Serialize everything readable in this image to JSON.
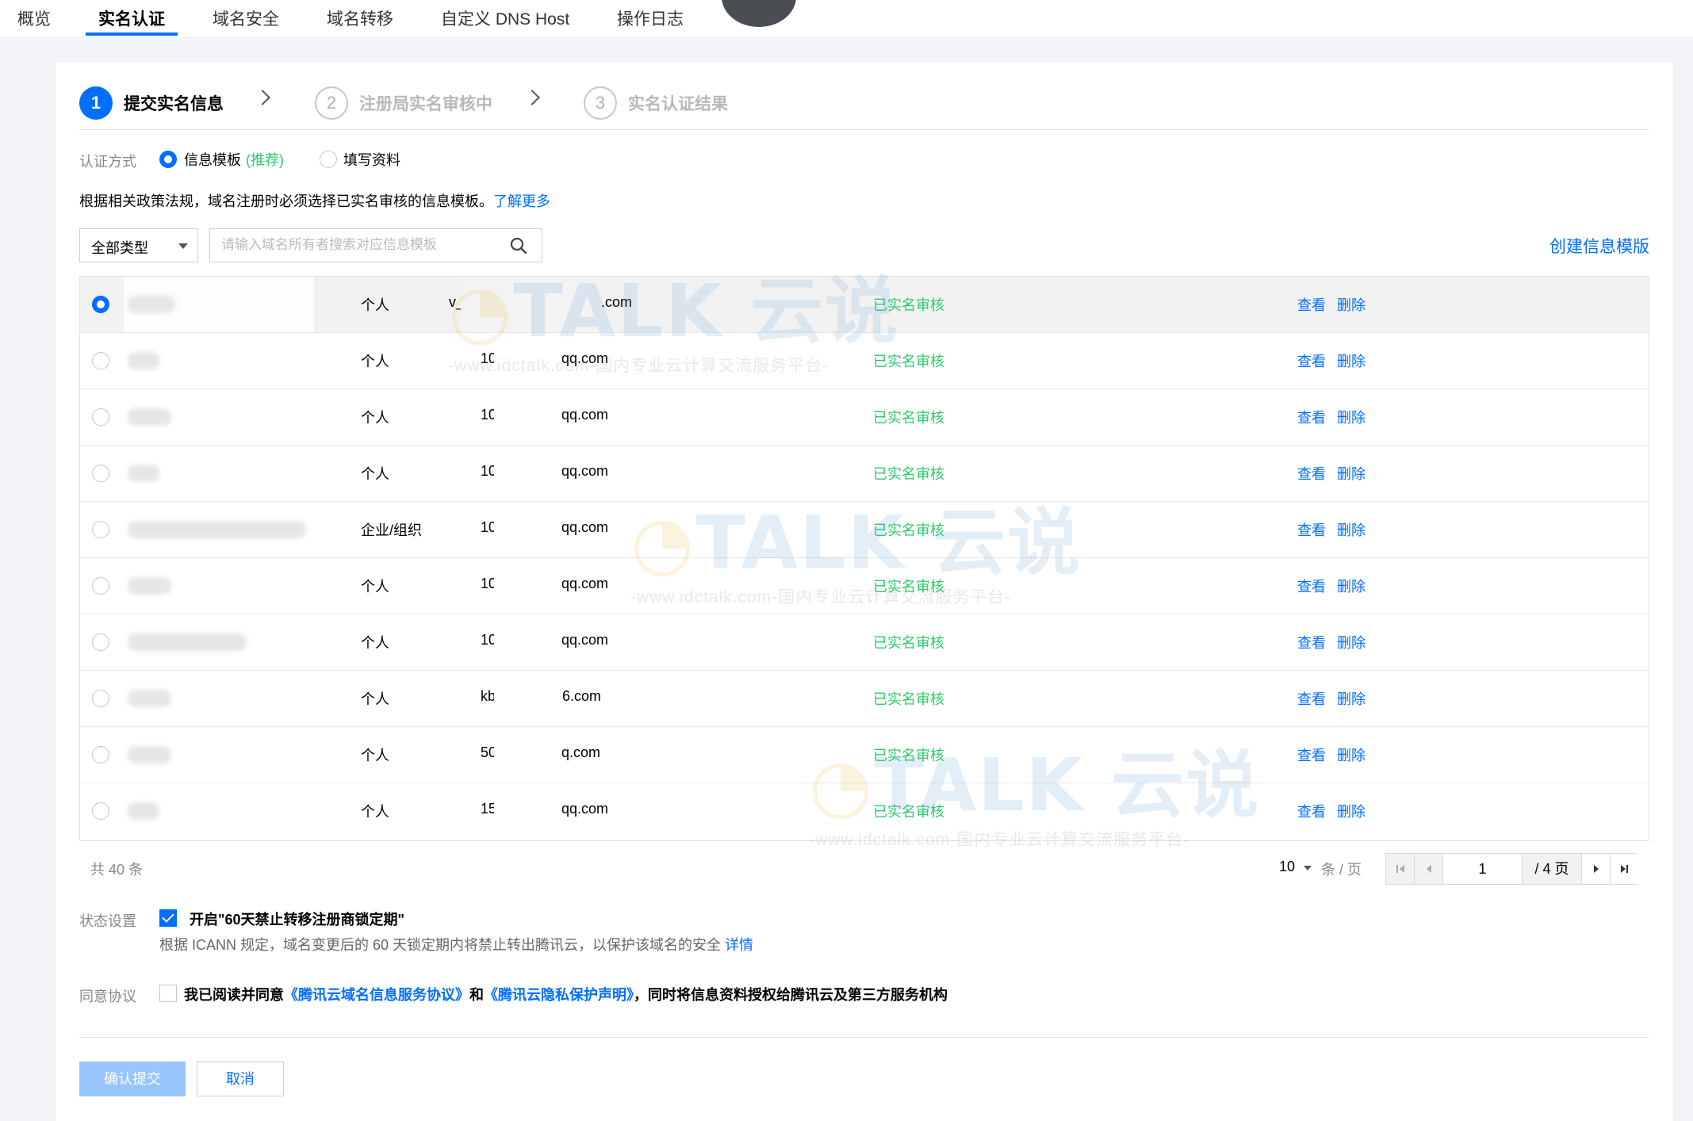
{
  "tabs": [
    {
      "label": "概览",
      "active": false
    },
    {
      "label": "实名认证",
      "active": true
    },
    {
      "label": "域名安全",
      "active": false
    },
    {
      "label": "域名转移",
      "active": false
    },
    {
      "label": "自定义 DNS Host",
      "active": false
    },
    {
      "label": "操作日志",
      "active": false
    }
  ],
  "steps": [
    {
      "num": "1",
      "label": "提交实名信息",
      "active": true
    },
    {
      "num": "2",
      "label": "注册局实名审核中",
      "active": false
    },
    {
      "num": "3",
      "label": "实名认证结果",
      "active": false
    }
  ],
  "auth": {
    "label": "认证方式",
    "option1": "信息模板",
    "option1_tag": "(推荐)",
    "option2": "填写资料",
    "selected": "信息模板"
  },
  "notice": {
    "text": "根据相关政策法规，域名注册时必须选择已实名审核的信息模板。",
    "link": "了解更多"
  },
  "filter": {
    "type_value": "全部类型",
    "search_placeholder": "请输入域名所有者搜索对应信息模板",
    "create_link": "创建信息模版"
  },
  "table": {
    "rows": [
      {
        "type": "个人",
        "email": "v_",
        "email_suffix": ".com",
        "status": "已实名审核",
        "view": "查看",
        "delete": "删除",
        "selected": true
      },
      {
        "type": "个人",
        "email": "10",
        "email_suffix": "qq.com",
        "status": "已实名审核",
        "view": "查看",
        "delete": "删除",
        "selected": false
      },
      {
        "type": "个人",
        "email": "10",
        "email_suffix": "qq.com",
        "status": "已实名审核",
        "view": "查看",
        "delete": "删除",
        "selected": false
      },
      {
        "type": "个人",
        "email": "10",
        "email_suffix": "qq.com",
        "status": "已实名审核",
        "view": "查看",
        "delete": "删除",
        "selected": false
      },
      {
        "type": "企业/组织",
        "email": "10",
        "email_suffix": "qq.com",
        "status": "已实名审核",
        "view": "查看",
        "delete": "删除",
        "selected": false
      },
      {
        "type": "个人",
        "email": "10",
        "email_suffix": "qq.com",
        "status": "已实名审核",
        "view": "查看",
        "delete": "删除",
        "selected": false
      },
      {
        "type": "个人",
        "email": "10",
        "email_suffix": "qq.com",
        "status": "已实名审核",
        "view": "查看",
        "delete": "删除",
        "selected": false
      },
      {
        "type": "个人",
        "email": "kb",
        "email_suffix": "6.com",
        "status": "已实名审核",
        "view": "查看",
        "delete": "删除",
        "selected": false
      },
      {
        "type": "个人",
        "email": "50",
        "email_suffix": "q.com",
        "status": "已实名审核",
        "view": "查看",
        "delete": "删除",
        "selected": false
      },
      {
        "type": "个人",
        "email": "15",
        "email_suffix": "qq.com",
        "status": "已实名审核",
        "view": "查看",
        "delete": "删除",
        "selected": false
      }
    ]
  },
  "pagination": {
    "total": "共 40 条",
    "page_size": "10",
    "page_unit": "条 / 页",
    "current": "1",
    "total_pages": "/ 4 页"
  },
  "status_setting": {
    "label": "状态设置",
    "checked": true,
    "title": "开启\"60天禁止转移注册商锁定期\"",
    "desc": "根据 ICANN 规定，域名变更后的 60 天锁定期内将禁止转出腾讯云，以保护该域名的安全",
    "link": "详情"
  },
  "agreement": {
    "label": "同意协议",
    "checked": false,
    "text1": "我已阅读并同意",
    "link1": "《腾讯云域名信息服务协议》",
    "text2": "和",
    "link2": "《腾讯云隐私保护声明》",
    "text3": "，同时将信息资料授权给腾讯云及第三方服务机构"
  },
  "buttons": {
    "submit": "确认提交",
    "cancel": "取消"
  },
  "watermark": {
    "logo_t": "TALK",
    "logo_cn": "云说",
    "url": "-www.idctalk.com-国内专业云计算交流服务平台-"
  },
  "colors": {
    "accent": "#006eff",
    "success": "#29cc6a",
    "submit_disabled": "#99c5ff"
  }
}
